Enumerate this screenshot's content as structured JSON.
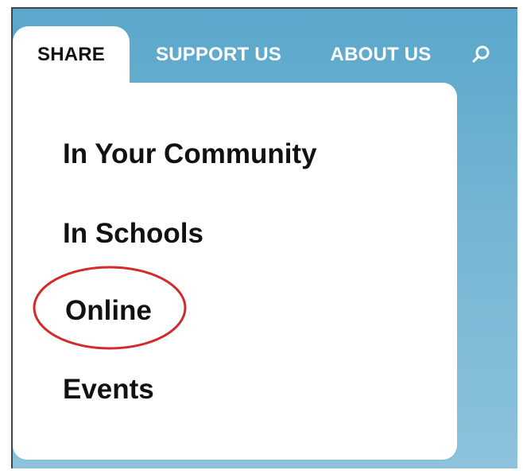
{
  "nav": {
    "tabs": [
      {
        "label": "SHARE"
      },
      {
        "label": "SUPPORT US"
      },
      {
        "label": "ABOUT US"
      }
    ],
    "search_icon": "search-icon"
  },
  "dropdown": {
    "items": [
      {
        "label": "In Your Community"
      },
      {
        "label": "In Schools"
      },
      {
        "label": "Online"
      },
      {
        "label": "Events"
      }
    ]
  },
  "colors": {
    "header_blue": "#5aa7cb",
    "dropdown_bg": "#ffffff",
    "highlight_red": "#d22b2b",
    "text_dark": "#111111"
  }
}
